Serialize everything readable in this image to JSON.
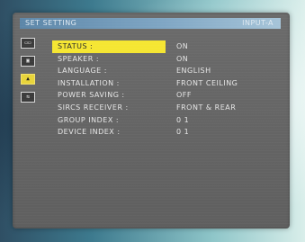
{
  "header": {
    "title": "SET SETTING",
    "input": "INPUT-A"
  },
  "sidebar": {
    "icons": [
      {
        "name": "picture-icon",
        "glyph": "▭▭"
      },
      {
        "name": "image-icon",
        "glyph": "▣"
      },
      {
        "name": "set-setting-icon",
        "glyph": "▲"
      },
      {
        "name": "input-icon",
        "glyph": "⇆"
      }
    ]
  },
  "menu": {
    "items": [
      {
        "label": "STATUS :",
        "value": "ON"
      },
      {
        "label": "SPEAKER :",
        "value": "ON"
      },
      {
        "label": "LANGUAGE :",
        "value": "ENGLISH"
      },
      {
        "label": "INSTALLATION :",
        "value": "FRONT CEILING"
      },
      {
        "label": "POWER SAVING :",
        "value": "OFF"
      },
      {
        "label": "SIRCS RECEIVER :",
        "value": "FRONT & REAR"
      },
      {
        "label": "GROUP INDEX :",
        "value": "0 1"
      },
      {
        "label": "DEVICE INDEX :",
        "value": "0 1"
      }
    ]
  },
  "colors": {
    "highlight": "#f5e632",
    "panel": "#636363",
    "title_bar": "#7fa6c4"
  }
}
